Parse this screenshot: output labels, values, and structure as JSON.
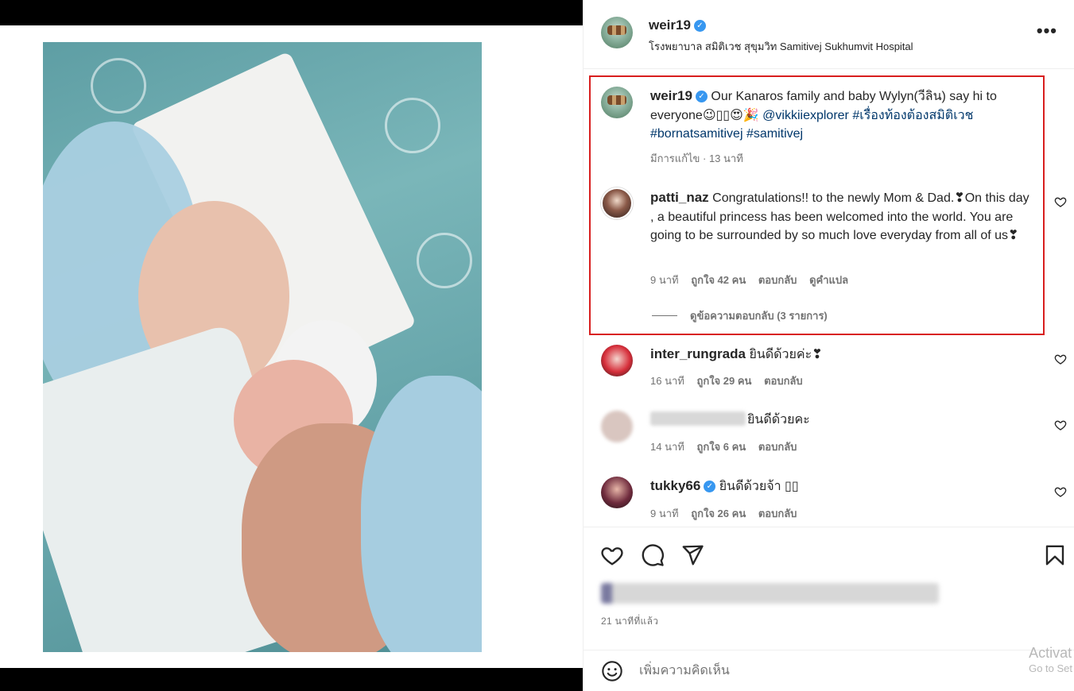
{
  "post": {
    "author": "weir19",
    "verified_mark": "✓",
    "location": "โรงพยาบาล สมิติเวช สุขุมวิท Samitivej Sukhumvit Hospital",
    "more_label": "•••"
  },
  "caption": {
    "username": "weir19",
    "text_start": "Our Kanaros family and baby Wylyn(วีลิน) say hi to everyone😉▯▯😍🎉 ",
    "mention": "@vikkiiexplorer",
    "hashtags": "#เรื่องท้องต้องสมิติเวช #bornatsamitivej #samitivej",
    "meta": "มีการแก้ไข · 13 นาที"
  },
  "comments": [
    {
      "username": "patti_naz",
      "text": "Congratulations!! to the newly Mom & Dad.❣On this day , a beautiful princess has been welcomed into the world. You are going to be surrounded by so much love everyday from all of us❣",
      "time": "9 นาที",
      "likes": "ถูกใจ 42 คน",
      "reply": "ตอบกลับ",
      "translate": "ดูคำแปล",
      "view_replies": "ดูข้อความตอบกลับ (3 รายการ)"
    },
    {
      "username": "inter_rungrada",
      "text": "ยินดีด้วยค่ะ❣",
      "time": "16 นาที",
      "likes": "ถูกใจ 29 คน",
      "reply": "ตอบกลับ"
    },
    {
      "username": "",
      "text": "ยินดีด้วยคะ",
      "time": "14 นาที",
      "likes": "ถูกใจ 6 คน",
      "reply": "ตอบกลับ"
    },
    {
      "username": "tukky66",
      "text": "ยินดีด้วยจ้า ▯▯",
      "time": "9 นาที",
      "likes": "ถูกใจ 26 คน",
      "reply": "ตอบกลับ"
    }
  ],
  "footer": {
    "time_ago": "21 นาทีที่แล้ว",
    "comment_placeholder": "เพิ่มความคิดเห็น",
    "watermark_line1": "Activat",
    "watermark_line2": "Go to Set"
  },
  "icons": {
    "like": "heart-icon",
    "comment": "comment-icon",
    "share": "share-icon",
    "save": "bookmark-icon",
    "emoji": "emoji-icon",
    "more": "more-icon"
  },
  "colors": {
    "highlight_border": "#d81e1e",
    "verified": "#3797f0",
    "hashtag": "#00376b",
    "meta_text": "#737373"
  }
}
